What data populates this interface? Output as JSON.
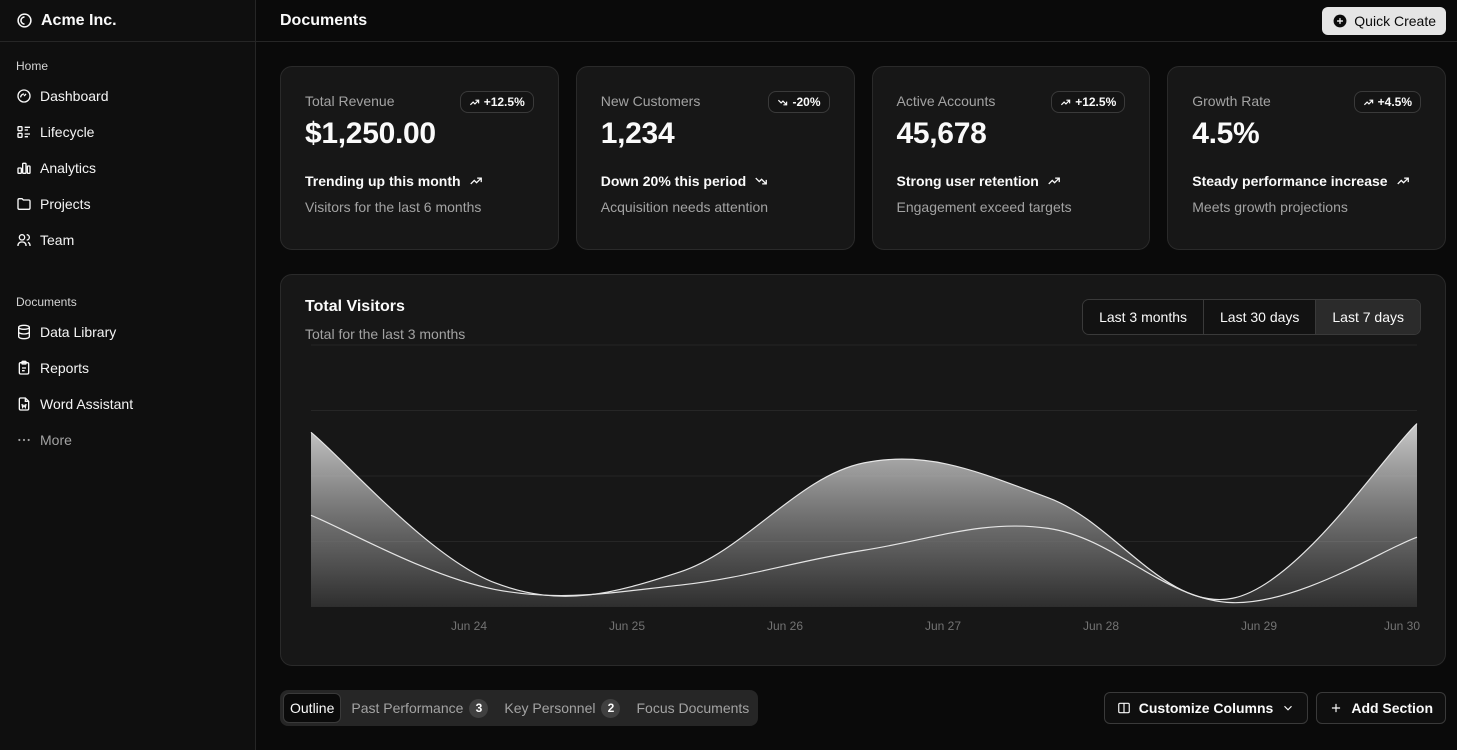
{
  "sidebar": {
    "brand": "Acme Inc.",
    "groups": [
      {
        "label": "Home",
        "items": [
          {
            "label": "Dashboard",
            "icon": "gauge-icon"
          },
          {
            "label": "Lifecycle",
            "icon": "list-details-icon"
          },
          {
            "label": "Analytics",
            "icon": "chart-bar-icon"
          },
          {
            "label": "Projects",
            "icon": "folder-icon"
          },
          {
            "label": "Team",
            "icon": "users-icon"
          }
        ]
      },
      {
        "label": "Documents",
        "items": [
          {
            "label": "Data Library",
            "icon": "database-icon"
          },
          {
            "label": "Reports",
            "icon": "clipboard-icon"
          },
          {
            "label": "Word Assistant",
            "icon": "file-word-icon"
          },
          {
            "label": "More",
            "icon": "dots-icon"
          }
        ]
      }
    ]
  },
  "header": {
    "title": "Documents",
    "quick_create": "Quick Create"
  },
  "cards": [
    {
      "label": "Total Revenue",
      "badge": "+12.5%",
      "badge_dir": "up",
      "value": "$1,250.00",
      "trend": "Trending up this month",
      "trend_dir": "up",
      "desc": "Visitors for the last 6 months"
    },
    {
      "label": "New Customers",
      "badge": "-20%",
      "badge_dir": "down",
      "value": "1,234",
      "trend": "Down 20% this period",
      "trend_dir": "down",
      "desc": "Acquisition needs attention"
    },
    {
      "label": "Active Accounts",
      "badge": "+12.5%",
      "badge_dir": "up",
      "value": "45,678",
      "trend": "Strong user retention",
      "trend_dir": "up",
      "desc": "Engagement exceed targets"
    },
    {
      "label": "Growth Rate",
      "badge": "+4.5%",
      "badge_dir": "up",
      "value": "4.5%",
      "trend": "Steady performance increase",
      "trend_dir": "up",
      "desc": "Meets growth projections"
    }
  ],
  "visitors": {
    "title": "Total Visitors",
    "subtitle": "Total for the last 3 months",
    "ranges": [
      "Last 3 months",
      "Last 30 days",
      "Last 7 days"
    ],
    "active_range": 2
  },
  "chart_data": {
    "type": "area",
    "x": [
      "Jun 24",
      "Jun 25",
      "Jun 26",
      "Jun 27",
      "Jun 28",
      "Jun 29",
      "Jun 30"
    ],
    "x_ticks": [
      "Jun 24",
      "Jun 25",
      "Jun 26",
      "Jun 27",
      "Jun 28",
      "Jun 29",
      "Jun 30"
    ],
    "series": [
      {
        "values": [
          400,
          55,
          80,
          330,
          250,
          20,
          420
        ]
      },
      {
        "values": [
          210,
          40,
          50,
          130,
          180,
          10,
          160
        ]
      }
    ],
    "stacked": true,
    "ylim": [
      0,
      600
    ],
    "grid": true,
    "legend": "none"
  },
  "bottom": {
    "tabs": [
      {
        "label": "Outline",
        "count": ""
      },
      {
        "label": "Past Performance",
        "count": "3"
      },
      {
        "label": "Key Personnel",
        "count": "2"
      },
      {
        "label": "Focus Documents",
        "count": ""
      }
    ],
    "active_tab": 0,
    "customize": "Customize Columns",
    "add_section": "Add Section"
  }
}
